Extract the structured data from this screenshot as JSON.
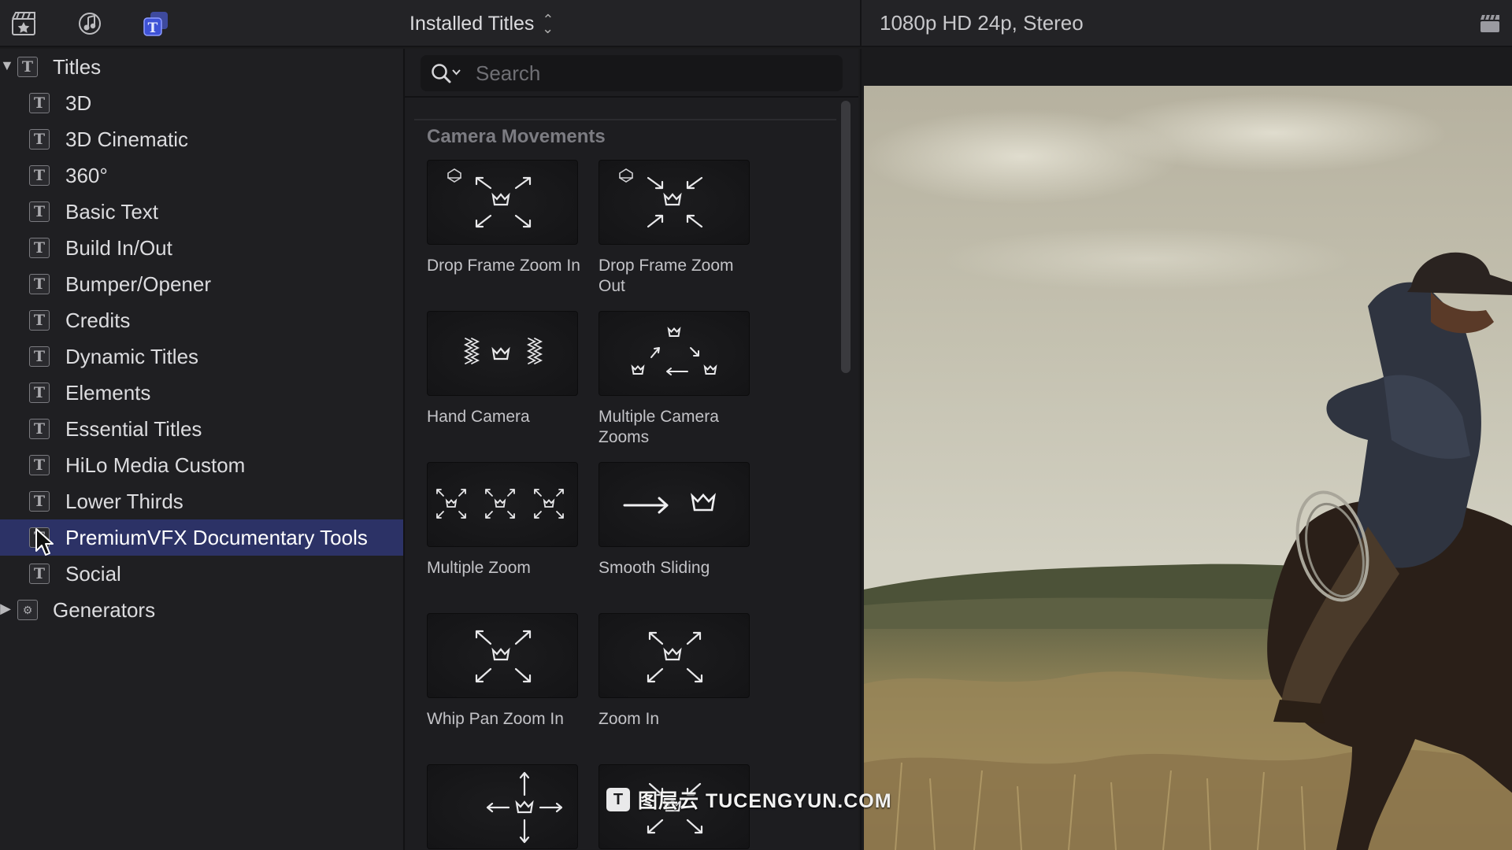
{
  "toolbar": {
    "icons": [
      "clapper-star-icon",
      "music-photos-icon",
      "titles-generators-icon"
    ],
    "library_dropdown": "Installed Titles"
  },
  "viewer": {
    "format_label": "1080p HD 24p, Stereo",
    "settings_icon": "clapperboard-icon"
  },
  "sidebar": {
    "root": {
      "label": "Titles",
      "expanded": true
    },
    "items": [
      {
        "label": "3D"
      },
      {
        "label": "3D Cinematic"
      },
      {
        "label": "360°"
      },
      {
        "label": "Basic Text"
      },
      {
        "label": "Build In/Out"
      },
      {
        "label": "Bumper/Opener"
      },
      {
        "label": "Credits"
      },
      {
        "label": "Dynamic Titles"
      },
      {
        "label": "Elements"
      },
      {
        "label": "Essential Titles"
      },
      {
        "label": "HiLo Media Custom"
      },
      {
        "label": "Lower Thirds"
      },
      {
        "label": "PremiumVFX Documentary Tools",
        "selected": true
      },
      {
        "label": "Social"
      }
    ],
    "generators": {
      "label": "Generators",
      "expanded": false
    }
  },
  "browser": {
    "search_placeholder": "Search",
    "section_title": "Camera Movements",
    "tiles": [
      {
        "label": "Drop Frame Zoom In",
        "icon": "zoom-out-arrows-crown-icon"
      },
      {
        "label": "Drop Frame Zoom Out",
        "icon": "zoom-in-arrows-crown-icon"
      },
      {
        "label": "Hand Camera",
        "icon": "shaky-crown-icon"
      },
      {
        "label": "Multiple Camera Zooms",
        "icon": "three-crowns-cycle-icon"
      },
      {
        "label": "Multiple Zoom",
        "icon": "triple-zoom-crown-icon"
      },
      {
        "label": "Smooth Sliding",
        "icon": "slide-arrow-crown-icon"
      },
      {
        "label": "Whip Pan Zoom In",
        "icon": "whip-zoom-crown-icon"
      },
      {
        "label": "Zoom In",
        "icon": "zoom-in-crown-icon"
      },
      {
        "label": "",
        "icon": "four-way-arrows-crown-icon"
      },
      {
        "label": "",
        "icon": "inward-arrows-crown-icon"
      }
    ]
  },
  "watermark": {
    "badge": "T",
    "text": "图层云 TUCENGYUN.COM"
  }
}
